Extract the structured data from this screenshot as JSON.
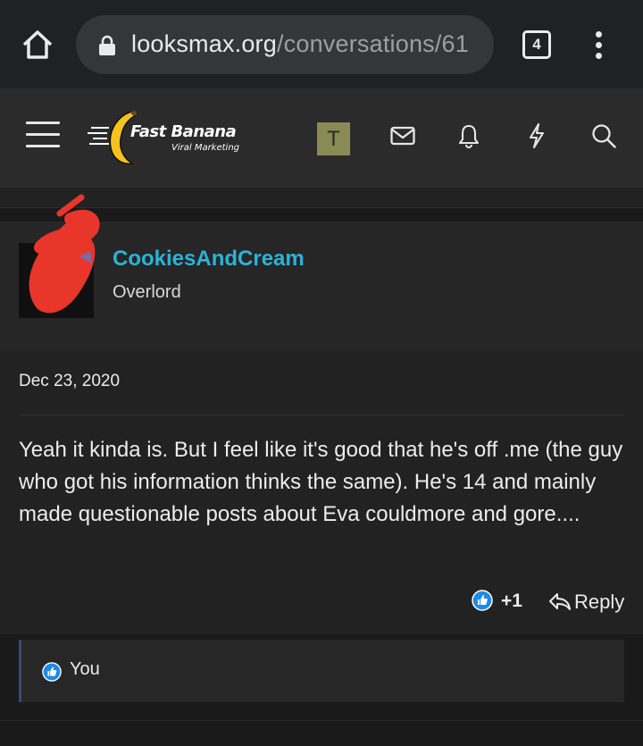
{
  "browser": {
    "url_host": "looksmax.org",
    "url_path": "/conversations/61",
    "tab_count": "4"
  },
  "site": {
    "logo_title": "Fast Banana",
    "logo_subtitle": "Viral Marketing",
    "account_initial": "T"
  },
  "message": {
    "username": "CookiesAndCream",
    "user_title": "Overlord",
    "date": "Dec 23, 2020",
    "body": "Yeah it kinda is. But I feel like it's good that he's off .me (the guy who got his information thinks the same). He's 14 and mainly made questionable posts about Eva couldmore and gore....",
    "reaction_count": "+1",
    "reply_label": "Reply",
    "reacted_by": "You"
  },
  "colors": {
    "accent_username": "#2bb3d6",
    "like_blue": "#1d8ae6",
    "scribble_red": "#e8362b"
  }
}
